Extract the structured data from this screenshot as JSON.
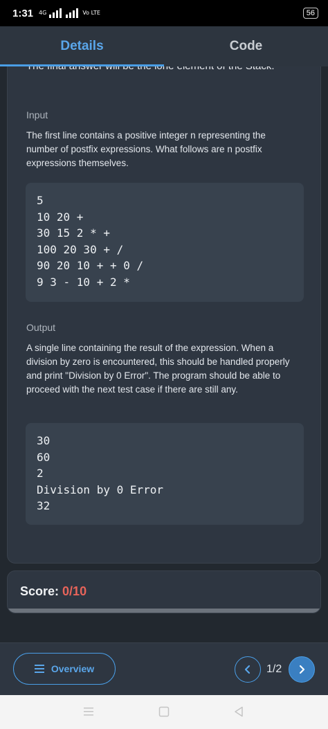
{
  "status_bar": {
    "time": "1:31",
    "network_small": "4G",
    "volte": "Vo LTE",
    "battery": "56"
  },
  "tabs": [
    {
      "label": "Details",
      "active": true
    },
    {
      "label": "Code",
      "active": false
    }
  ],
  "details": {
    "cut_off_text": "The final answer will be the lone element of the Stack.",
    "input_label": "Input",
    "input_description": "The first line contains a positive integer n representing the number of postfix expressions. What follows are n postfix expressions themselves.",
    "input_sample": [
      "5",
      "10 20 +",
      "30 15 2 * +",
      "100 20 30 + /",
      "90 20 10 + + 0 /",
      "9 3 - 10 + 2 *"
    ],
    "output_label": "Output",
    "output_description": "A single line containing the result of the expression. When a division by zero is encountered, this should be handled properly and print \"Division by 0 Error\". The program should be able to proceed with the next test case if there are still any.",
    "output_sample": [
      "30",
      "60",
      "2",
      "Division by 0 Error",
      "32"
    ]
  },
  "score": {
    "label": "Score:",
    "value": "0/10"
  },
  "bottom_nav": {
    "overview_label": "Overview",
    "page_indicator": "1/2"
  },
  "colors": {
    "accent": "#4a9ee6",
    "score_value": "#e8645a",
    "background": "#22282f",
    "card": "#2e3641",
    "code_bg": "#38424e"
  },
  "icons": {
    "overview": "menu-icon",
    "prev": "chevron-left-icon",
    "next": "chevron-right-icon",
    "android_menu": "android-recents-icon",
    "android_home": "android-home-icon",
    "android_back": "android-back-icon"
  }
}
